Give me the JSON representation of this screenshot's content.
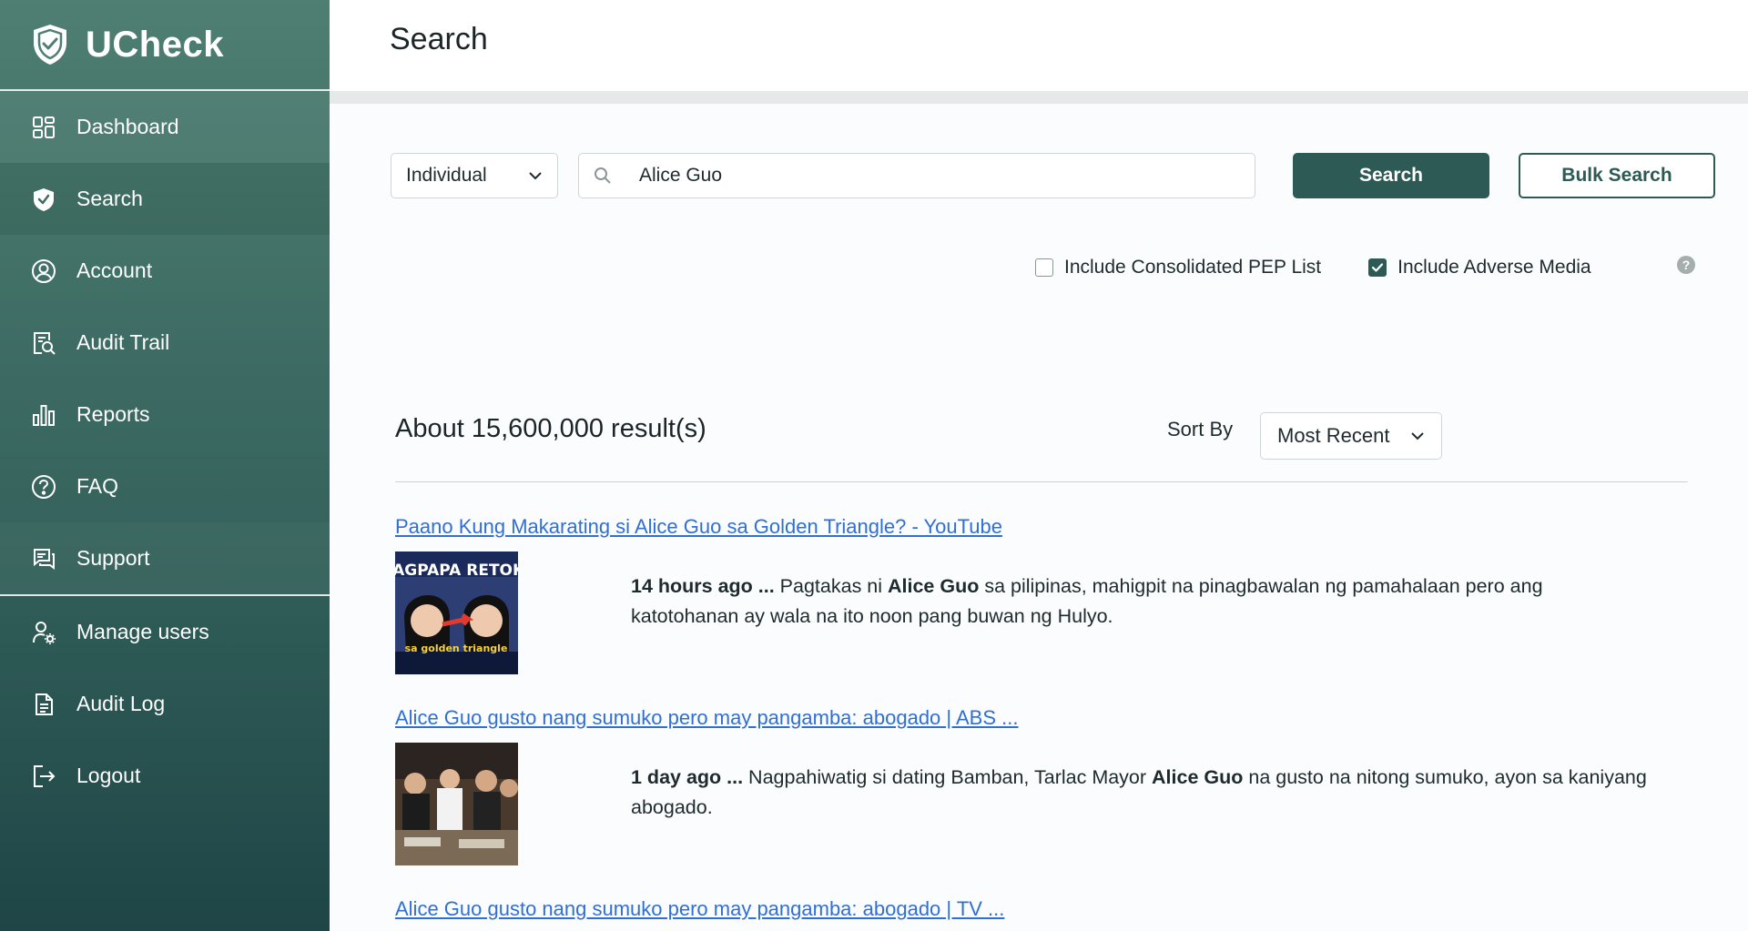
{
  "brand": {
    "name": "UCheck"
  },
  "sidebar": {
    "items": [
      {
        "label": "Dashboard",
        "icon": "dashboard-grid-icon"
      },
      {
        "label": "Search",
        "icon": "shield-check-icon"
      },
      {
        "label": "Account",
        "icon": "user-circle-icon"
      },
      {
        "label": "Audit Trail",
        "icon": "document-search-icon"
      },
      {
        "label": "Reports",
        "icon": "bar-chart-icon"
      },
      {
        "label": "FAQ",
        "icon": "question-circle-icon"
      },
      {
        "label": "Support",
        "icon": "chat-icon"
      }
    ],
    "admin_items": [
      {
        "label": "Manage users",
        "icon": "user-gear-icon"
      },
      {
        "label": "Audit Log",
        "icon": "document-icon"
      },
      {
        "label": "Logout",
        "icon": "logout-icon"
      }
    ]
  },
  "header": {
    "title": "Search"
  },
  "search": {
    "type_selected": "Individual",
    "query": "Alice Guo",
    "search_label": "Search",
    "bulk_label": "Bulk Search"
  },
  "options": {
    "pep_label": "Include Consolidated PEP List",
    "pep_checked": false,
    "adverse_label": "Include Adverse Media",
    "adverse_checked": true,
    "help": "?"
  },
  "results": {
    "count_text": "About 15,600,000 result(s)",
    "sort_label": "Sort By",
    "sort_selected": "Most Recent",
    "items": [
      {
        "title": "Paano Kung Makarating si Alice Guo sa Golden Triangle? - YouTube",
        "time": "14 hours ago ...",
        "pre": " Pagtakas ni ",
        "bold": "Alice Guo",
        "post": " sa pilipinas, mahigpit na pinagbawalan ng pamahalaan pero ang katotohanan ay wala na ito noon pang buwan ng Hulyo.",
        "thumb_top_text": "MAGPAPA RETOKE",
        "thumb_bottom_text": "sa golden triangle"
      },
      {
        "title": "Alice Guo gusto nang sumuko pero may pangamba: abogado | ABS ...",
        "time": "1 day ago ...",
        "pre": " Nagpahiwatig si dating Bamban, Tarlac Mayor ",
        "bold": "Alice Guo",
        "post": " na gusto na nitong sumuko, ayon sa kaniyang abogado."
      },
      {
        "title": "Alice Guo gusto nang sumuko pero may pangamba: abogado | TV ..."
      }
    ]
  },
  "colors": {
    "accent": "#2e5a56",
    "link": "#2f6fd6"
  }
}
